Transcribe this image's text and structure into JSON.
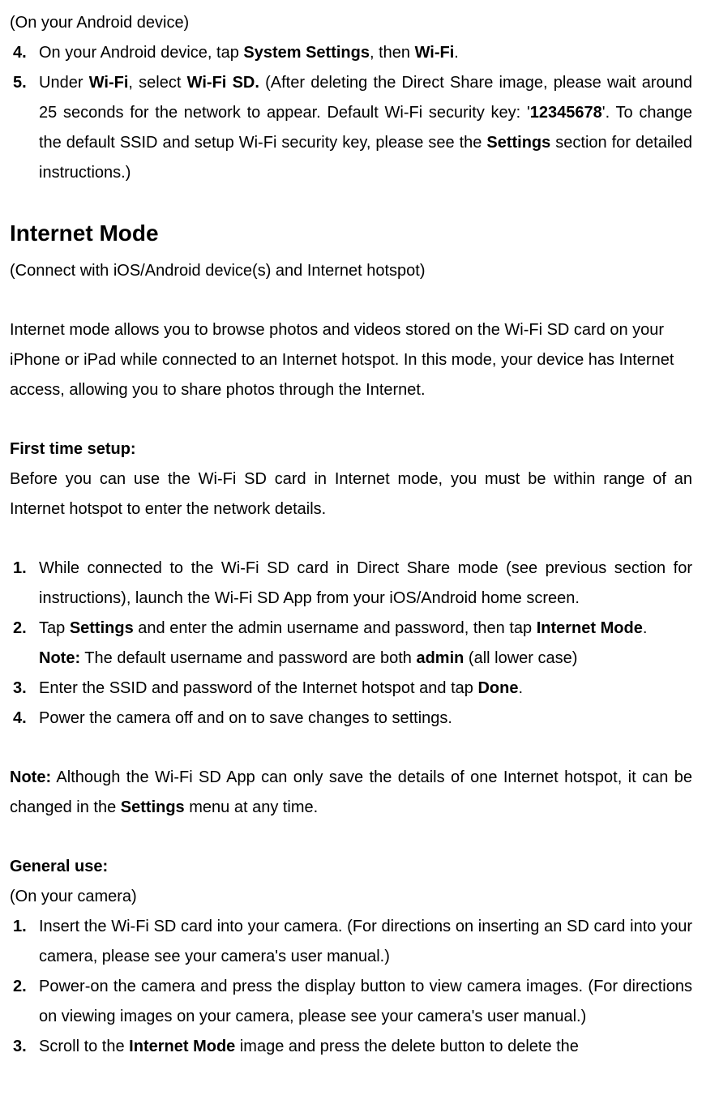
{
  "intro_line": "(On your Android device)",
  "steps_a": {
    "item4": {
      "num": "4.",
      "prefix": "On your Android device, tap ",
      "bold1": "System Settings",
      "mid": ", then ",
      "bold2": "Wi-Fi",
      "suffix": "."
    },
    "item5": {
      "num": "5.",
      "prefix": "Under ",
      "bold1": "Wi-Fi",
      "mid1": ", select ",
      "bold2": "Wi-Fi SD.",
      "mid2": " (After deleting the Direct Share image, please wait around 25 seconds for the network to appear. Default Wi-Fi security key: '",
      "bold3": "12345678",
      "mid3": "'. To change the default SSID and setup Wi-Fi security key, please see the ",
      "bold4": "Settings",
      "suffix": " section for detailed instructions.)"
    }
  },
  "h2_internet_mode": "Internet Mode",
  "subtitle": "(Connect with iOS/Android device(s) and Internet hotspot)",
  "intro_paragraph": "Internet mode allows you to browse photos and videos stored on the Wi-Fi SD card on your iPhone or iPad while connected to an Internet hotspot. In this mode, your device has Internet access, allowing you to share photos through the Internet.",
  "first_time_setup_heading": "First time setup:",
  "first_time_setup_para": "Before you can use the Wi-Fi SD card in Internet mode, you must be within range of an Internet hotspot to enter the network details.",
  "steps_b": {
    "item1": {
      "num": "1.",
      "text": "While connected to the Wi-Fi SD card in Direct Share mode (see previous section for instructions), launch the Wi-Fi SD App from your iOS/Android home screen."
    },
    "item2": {
      "num": "2.",
      "prefix": "Tap ",
      "bold1": "Settings",
      "mid1": " and enter the admin username and password, then tap ",
      "bold2": "Internet Mode",
      "suffix1": ".",
      "note_bold": "Note:",
      "note_mid": " The default username and password are both ",
      "note_bold2": "admin",
      "note_suffix": " (all lower case)"
    },
    "item3": {
      "num": "3.",
      "prefix": "Enter the SSID and password of the Internet hotspot and tap ",
      "bold1": "Done",
      "suffix": "."
    },
    "item4": {
      "num": "4.",
      "text": "Power the camera off and on to save changes to settings."
    }
  },
  "note_para": {
    "bold1": "Note:",
    "mid": " Although the Wi-Fi SD App can only save the details of one Internet hotspot, it can be changed in the ",
    "bold2": "Settings",
    "suffix": " menu at any time."
  },
  "general_use_heading": "General use:",
  "general_use_sub": "(On your camera)",
  "steps_c": {
    "item1": {
      "num": "1.",
      "text": "Insert the Wi-Fi SD card into your camera. (For directions on inserting an SD card into your camera, please see your camera's user manual.)"
    },
    "item2": {
      "num": "2.",
      "text": "Power-on the camera and press the display button to view camera images. (For directions on viewing images on your camera, please see your camera's user manual.)"
    },
    "item3": {
      "num": "3.",
      "prefix": "Scroll to the ",
      "bold1": "Internet Mode",
      "suffix": " image and press the delete button to delete the"
    }
  }
}
